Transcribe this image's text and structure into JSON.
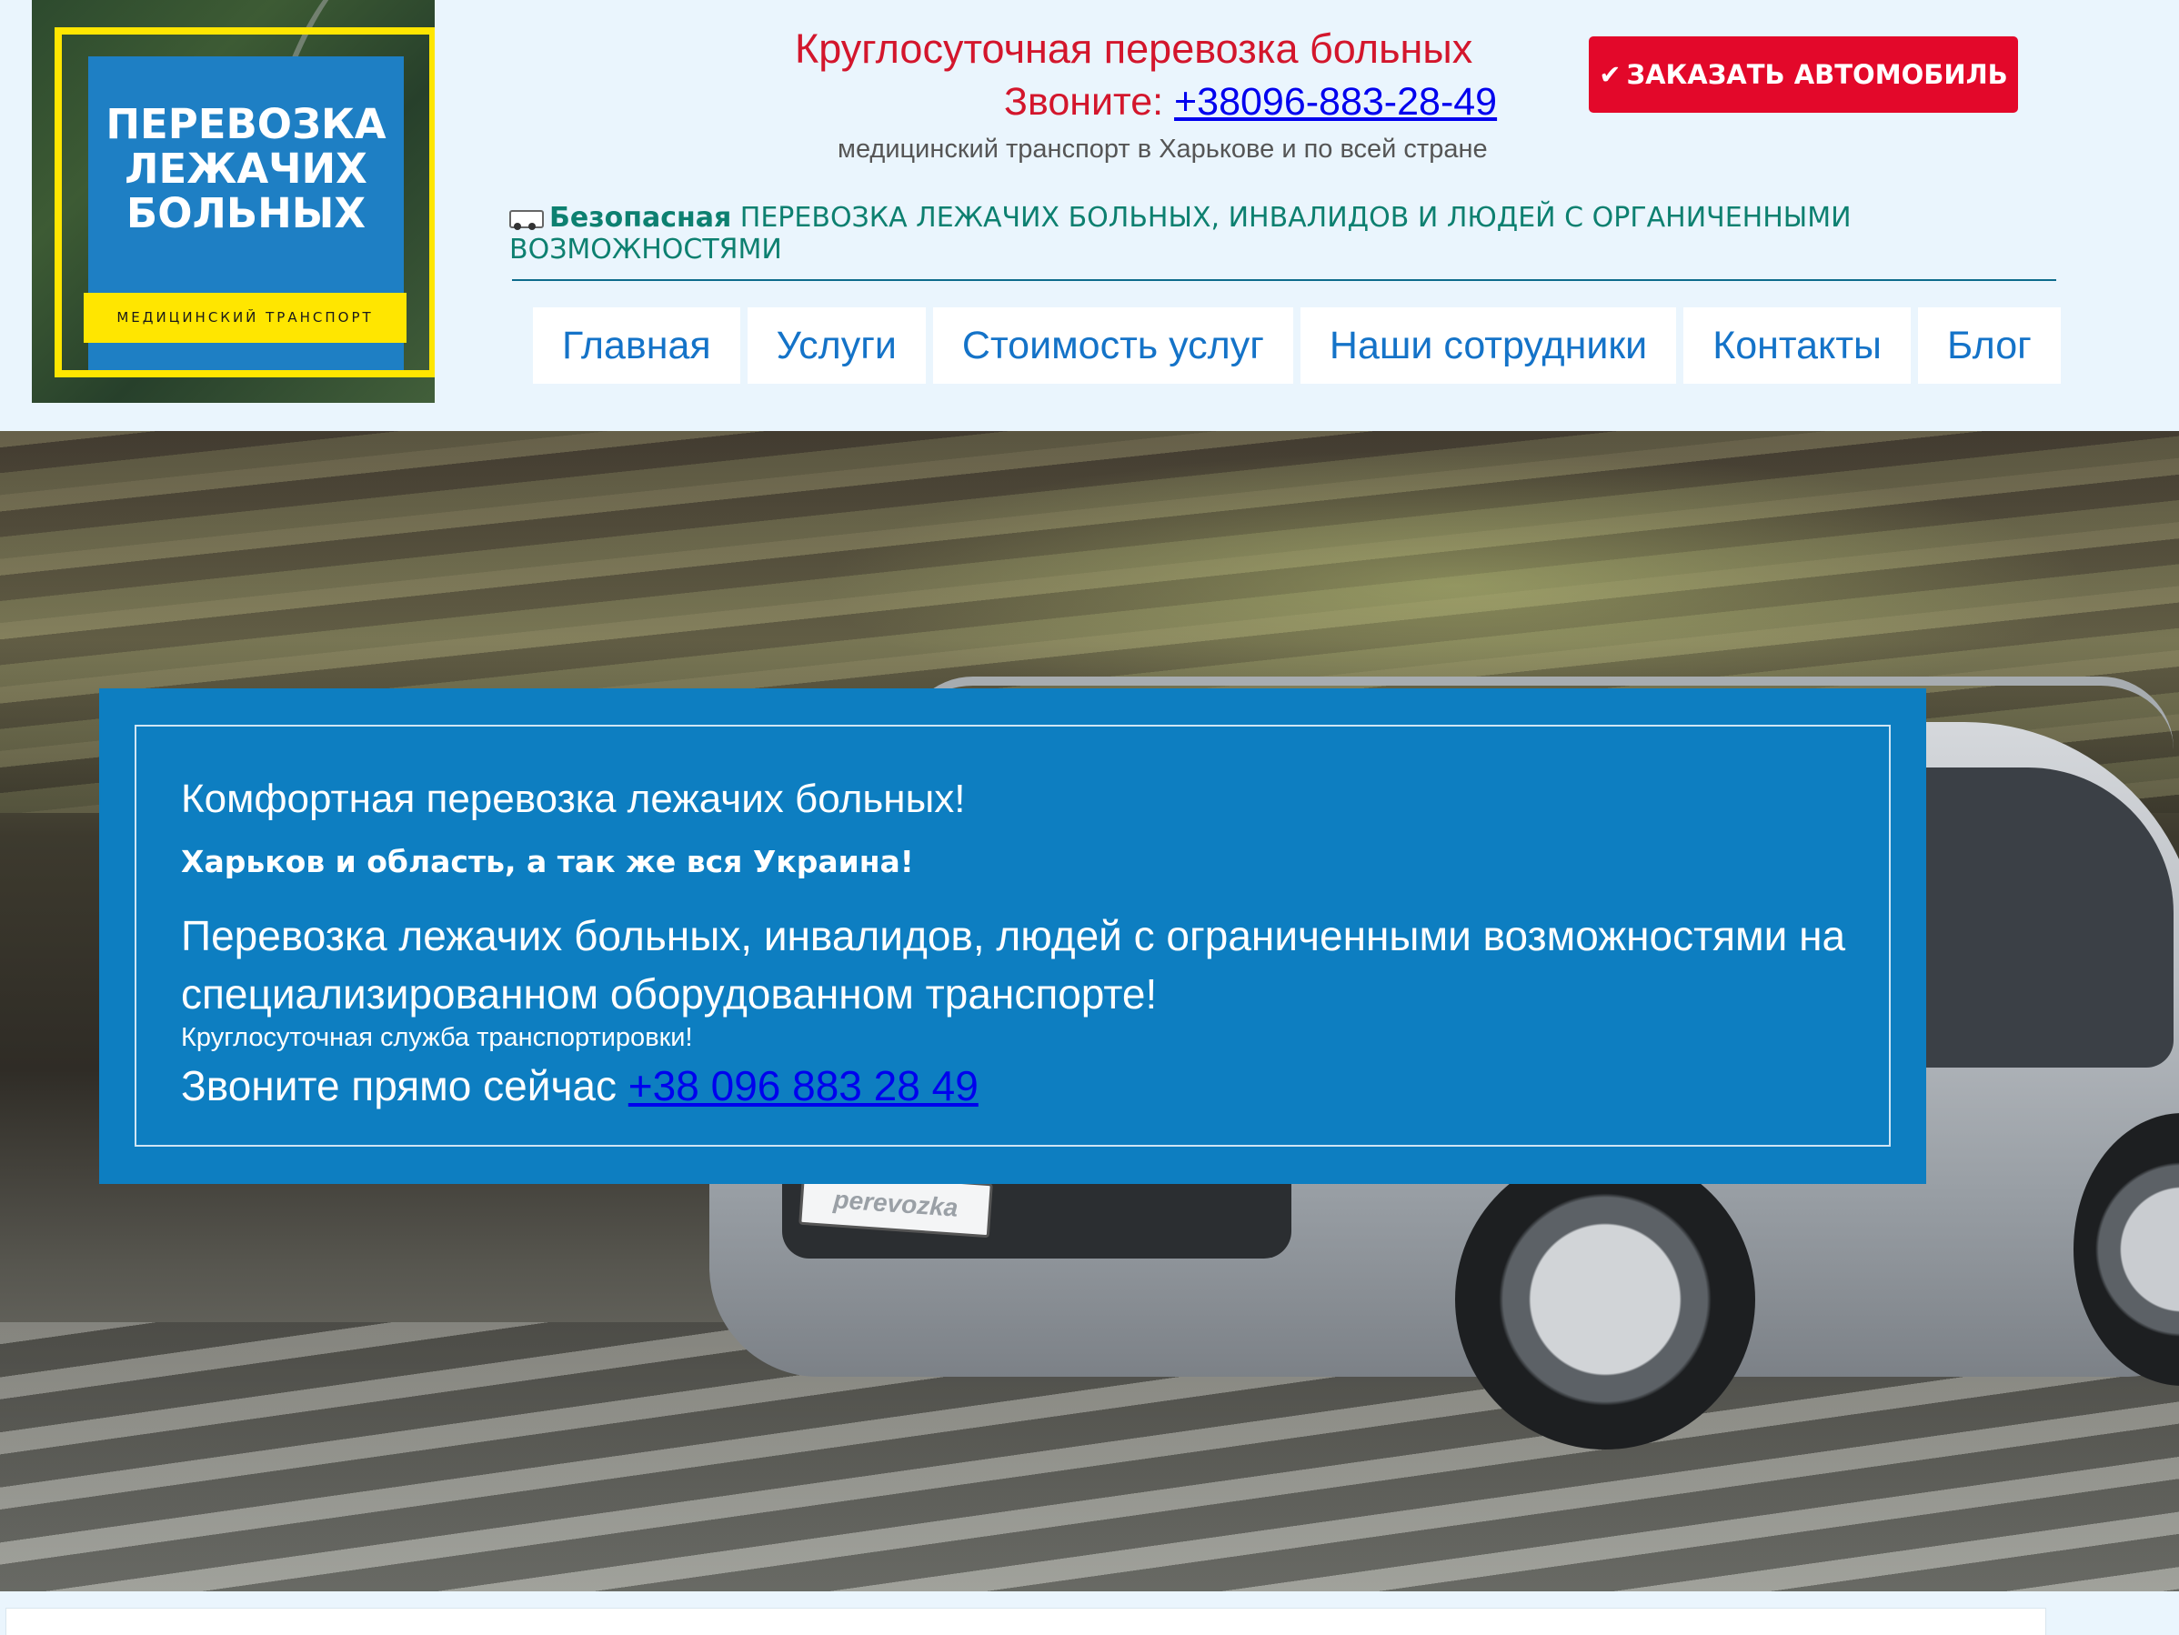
{
  "logo": {
    "title": "ПЕРЕВОЗКА ЛЕЖАЧИХ БОЛЬНЫХ",
    "strip": "МЕДИЦИНСКИЙ ТРАНСПОРТ"
  },
  "header": {
    "title": "Круглосуточная перевозка больных",
    "phone_prefix": "Звоните: ",
    "phone": "+38096-883-28-49",
    "subtitle": "медицинский транспорт в Харькове и по всей стране",
    "order_button": "ЗАКАЗАТЬ АВТОМОБИЛЬ",
    "tagline_lead": "Безопасная",
    "tagline_rest": "ПЕРЕВОЗКА ЛЕЖАЧИХ БОЛЬНЫХ, ИНВАЛИДОВ И ЛЮДЕЙ С ОРГАНИЧЕННЫМИ ВОЗМОЖНОСТЯМИ"
  },
  "nav": {
    "items": [
      "Главная",
      "Услуги",
      "Стоимость услуг",
      "Наши сотрудники",
      "Контакты",
      "Блог"
    ]
  },
  "hero": {
    "plate_text": "perevozka",
    "heading": "Комфортная перевозка лежачих больных!",
    "region": "Харьков и область, а так же вся Украина!",
    "description": "Перевозка лежачих больных, инвалидов, людей с ограниченными возможностями на специализированном оборудованном транспорте!",
    "service": "Круглосуточная служба транспортировки!",
    "call_prefix": "Звоните прямо сейчас ",
    "call_phone": "+38 096 883 28 49"
  },
  "colors": {
    "header_bg": "#eaf5fd",
    "brand_red": "#e3082a",
    "link_blue": "#0000ee",
    "nav_text": "#1473c8",
    "promo_bg": "#0d7ec1",
    "tagline": "#0d8070"
  },
  "icons": [
    "ambulance-icon",
    "check-icon"
  ]
}
